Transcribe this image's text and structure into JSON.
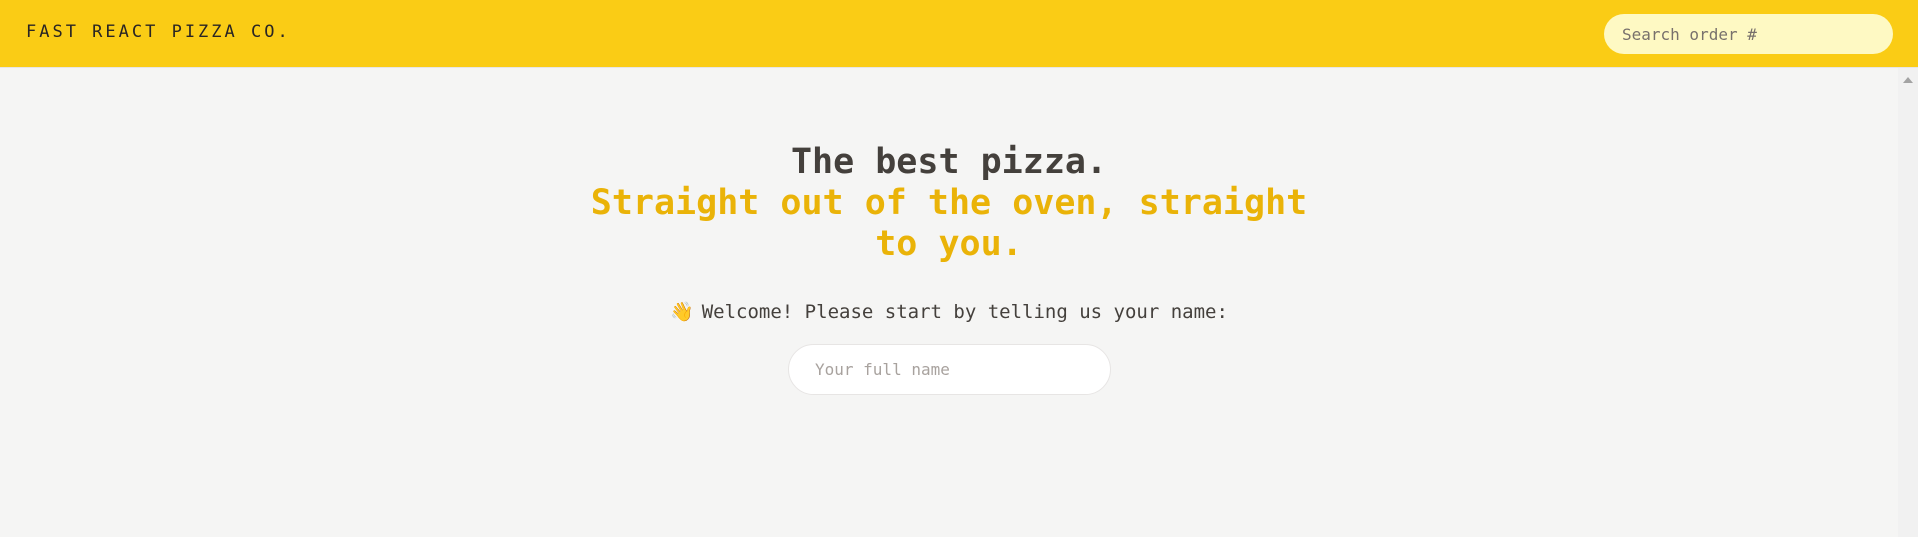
{
  "header": {
    "logo": "FAST REACT PIZZA CO.",
    "search_placeholder": "Search order #"
  },
  "hero": {
    "title_line1": "The best pizza.",
    "title_line2": "Straight out of the oven, straight to you."
  },
  "welcome": {
    "emoji": "👋",
    "text": "Welcome! Please start by telling us your name:",
    "name_placeholder": "Your full name"
  },
  "colors": {
    "header_bg": "#facc15",
    "accent": "#eab308",
    "search_bg": "#fef9c3",
    "page_bg": "#f5f5f4"
  }
}
